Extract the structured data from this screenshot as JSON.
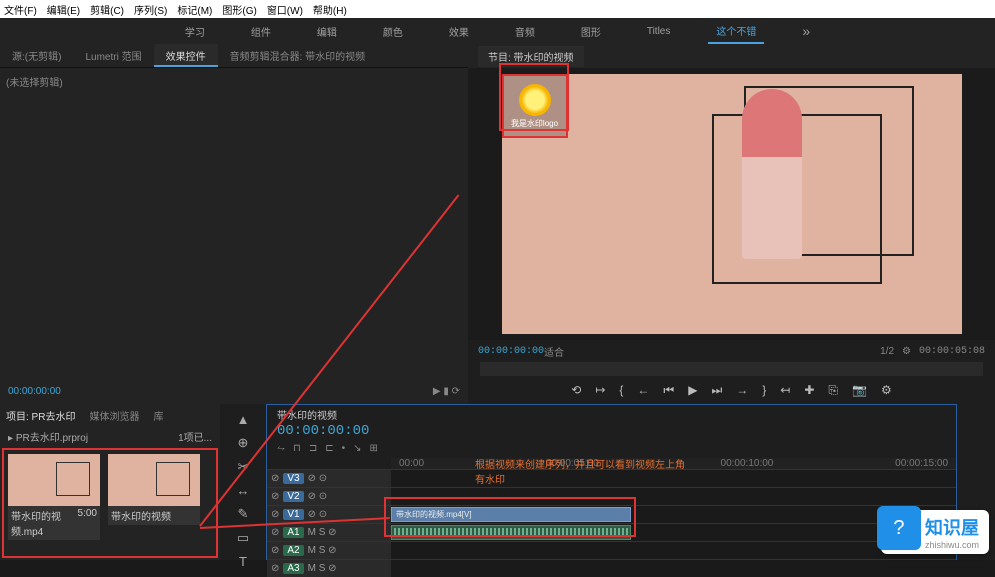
{
  "menu": [
    "文件(F)",
    "编辑(E)",
    "剪辑(C)",
    "序列(S)",
    "标记(M)",
    "图形(G)",
    "窗口(W)",
    "帮助(H)"
  ],
  "workspaces": {
    "items": [
      "学习",
      "组件",
      "编辑",
      "颜色",
      "效果",
      "音频",
      "图形",
      "Titles"
    ],
    "extra": "这个不错",
    "more": "»"
  },
  "effects_panel": {
    "tabs": [
      "源:(无剪辑)",
      "Lumetri 范围",
      "效果控件",
      "音频剪辑混合器: 带水印的视频"
    ],
    "selected": 2,
    "body": "(未选择剪辑)",
    "footer_time": "00:00:00:00"
  },
  "program": {
    "title": "节目: 带水印的视频",
    "watermark_text": "我是水印logo",
    "fit_label": "适合",
    "scale": "1/2",
    "pos_time": "00:00:00:00",
    "dur_time": "00:00:05:08"
  },
  "transport_icons": [
    "⟲",
    "↦",
    "{",
    "←",
    "⏮",
    "▶",
    "⏭",
    "→",
    "}",
    "↤",
    "✚",
    "⎘",
    "📷",
    "⚙"
  ],
  "project": {
    "tabs": [
      "项目: PR去水印",
      "媒体浏览器",
      "库"
    ],
    "bin_icon": "▸",
    "bin": "PR去水印.prproj",
    "count": "1项已...",
    "thumbs": [
      {
        "label": "带水印的视频.mp4",
        "dur": "5:00"
      },
      {
        "label": "带水印的视频",
        "dur": ""
      }
    ]
  },
  "tools": [
    "▲",
    "⊕",
    "✂",
    "↔",
    "✎",
    "▭",
    "T"
  ],
  "timeline": {
    "title": "带水印的视频",
    "playhead": "00:00:00:00",
    "toolbar_icons": [
      "⥊",
      "⊓",
      "⊐",
      "⊏",
      "•",
      "↘",
      "⊞"
    ],
    "ruler": [
      "00:00",
      "00:00:05:00",
      "00:00:10:00",
      "00:00:15:00"
    ],
    "v_tracks": [
      {
        "name": "V3",
        "mute": "⊘"
      },
      {
        "name": "V2",
        "mute": "⊘"
      },
      {
        "name": "V1",
        "mute": "⊘",
        "clip": "带水印的视频.mp4[V]"
      }
    ],
    "a_tracks": [
      {
        "name": "A1",
        "flags": "M S ⊘"
      },
      {
        "name": "A2",
        "flags": "M S ⊘"
      },
      {
        "name": "A3",
        "flags": "M S ⊘"
      }
    ]
  },
  "annotation": {
    "text1": "根据视频来创建序列，并且可以看到视频左上角",
    "text2": "有水印"
  },
  "brand": {
    "name": "知识屋",
    "domain": "zhishiwu.com",
    "icon": "?"
  }
}
